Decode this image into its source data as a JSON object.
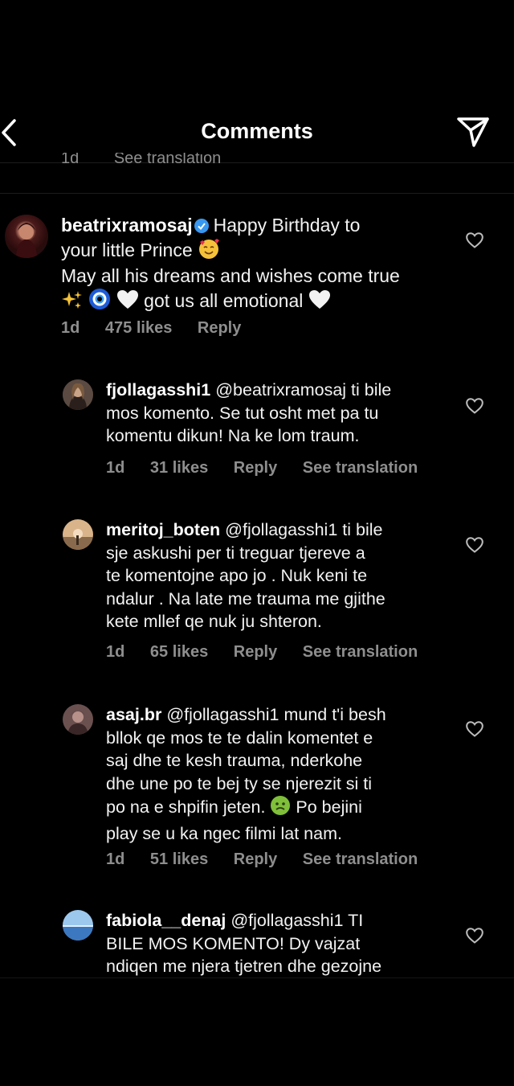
{
  "header": {
    "title": "Comments"
  },
  "previous": {
    "time": "1d",
    "see_translation": "See translation"
  },
  "comments": [
    {
      "username": "beatrixramosaj",
      "line1": "Happy Birthday to",
      "line2": "your little Prince",
      "line3": "May all his dreams and wishes come true",
      "line4": "got us all emotional",
      "time": "1d",
      "likes": "475 likes",
      "reply": "Reply"
    },
    {
      "username": "fjollagasshi1",
      "mention": "@beatrixramosaj",
      "line1": "ti bile",
      "line2": "mos komento. Se tut osht met pa tu",
      "line3": "komentu dikun! Na ke lom traum.",
      "time": "1d",
      "likes": "31 likes",
      "reply": "Reply",
      "see_translation": "See translation"
    },
    {
      "username": "meritoj_boten",
      "mention": "@fjollagasshi1",
      "line1": "ti bile",
      "line2": "sje askushi per ti treguar tjereve a",
      "line3": "te komentojne apo jo . Nuk keni te",
      "line4": "ndalur . Na late me trauma me gjithe",
      "line5": "kete mllef qe nuk ju shteron.",
      "time": "1d",
      "likes": "65 likes",
      "reply": "Reply",
      "see_translation": "See translation"
    },
    {
      "username": "asaj.br",
      "mention": "@fjollagasshi1",
      "line1": "mund t'i besh",
      "line2": "bllok qe mos te te dalin komentet e",
      "line3": "saj dhe te kesh trauma, nderkohe",
      "line4": "dhe une po te bej ty se njerezit si ti",
      "line5a": "po na e shpifin jeten.",
      "line5b": "Po bejini",
      "line6": "play se u ka ngec filmi lat nam.",
      "time": "1d",
      "likes": "51 likes",
      "reply": "Reply",
      "see_translation": "See translation"
    },
    {
      "username": "fabiola__denaj",
      "mention": "@fjollagasshi1",
      "line1": "TI",
      "line2": "BILE MOS KOMENTO! Dy vajzat",
      "line3": "ndiqen me njera tjetren dhe gezojne"
    }
  ],
  "icons": {
    "back": "chevron-left-icon",
    "send": "paper-plane-icon",
    "like": "heart-outline-icon",
    "verified": "verified-badge-icon"
  },
  "colors": {
    "background": "#000000",
    "meta": "#8e8e8e",
    "verified": "#3897f0"
  }
}
